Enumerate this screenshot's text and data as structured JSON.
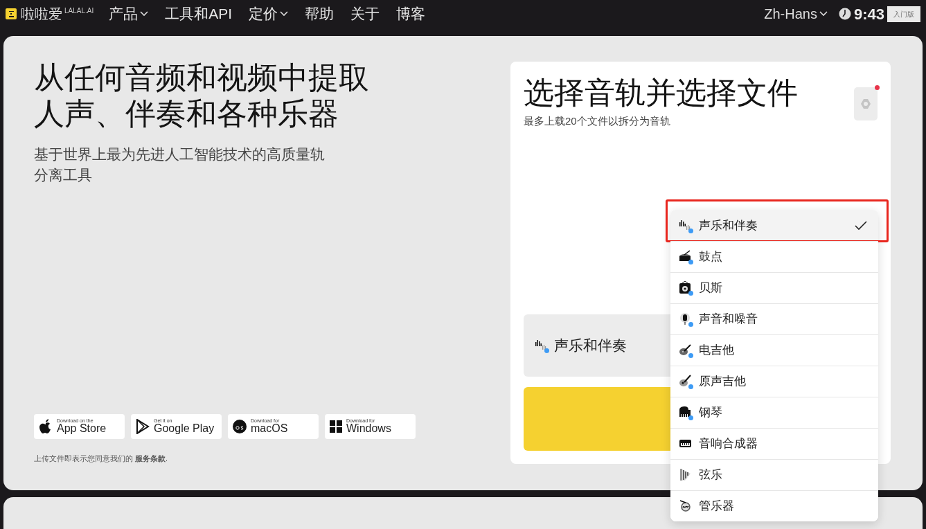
{
  "nav": {
    "logo": "啦啦爱",
    "logo_sup": "LALAL.AI",
    "items": [
      {
        "label": "产品",
        "dropdown": true
      },
      {
        "label": "工具和API",
        "dropdown": false
      },
      {
        "label": "定价",
        "dropdown": true
      },
      {
        "label": "帮助",
        "dropdown": false
      },
      {
        "label": "关于",
        "dropdown": false
      },
      {
        "label": "博客",
        "dropdown": false
      }
    ],
    "language": "Zh-Hans",
    "time": "9:43",
    "plan": "入门版"
  },
  "hero": {
    "title": "从任何音频和视频中提取人声、伴奏和各种乐器",
    "subtitle": "基于世界上最为先进人工智能技术的高质量轨分离工具",
    "stores": [
      {
        "small": "Download on the",
        "big": "App Store"
      },
      {
        "small": "Get it on",
        "big": "Google Play"
      },
      {
        "small": "Download for",
        "big": "macOS"
      },
      {
        "small": "Download for",
        "big": "Windows"
      }
    ],
    "terms": "上传文件即表示您同意我们的 **服务条款**."
  },
  "card": {
    "title": "选择音轨并选择文件",
    "subtitle": "最多上载20个文件以拆分为音轨",
    "settings_notification": true,
    "selected_track": "声乐和伴奏"
  },
  "dropdown": [
    {
      "label": "声乐和伴奏",
      "selected": true,
      "highlighted": true,
      "dot": true
    },
    {
      "label": "鼓点",
      "selected": false,
      "highlighted": false,
      "dot": true
    },
    {
      "label": "贝斯",
      "selected": false,
      "highlighted": false,
      "dot": true
    },
    {
      "label": "声音和噪音",
      "selected": false,
      "highlighted": false,
      "dot": true
    },
    {
      "label": "电吉他",
      "selected": false,
      "highlighted": false,
      "dot": true
    },
    {
      "label": "原声吉他",
      "selected": false,
      "highlighted": false,
      "dot": true
    },
    {
      "label": "钢琴",
      "selected": false,
      "highlighted": false,
      "dot": true
    },
    {
      "label": "音响合成器",
      "selected": false,
      "highlighted": false,
      "dot": false
    },
    {
      "label": "弦乐",
      "selected": false,
      "highlighted": false,
      "dot": false
    },
    {
      "label": "管乐器",
      "selected": false,
      "highlighted": false,
      "dot": false
    }
  ]
}
